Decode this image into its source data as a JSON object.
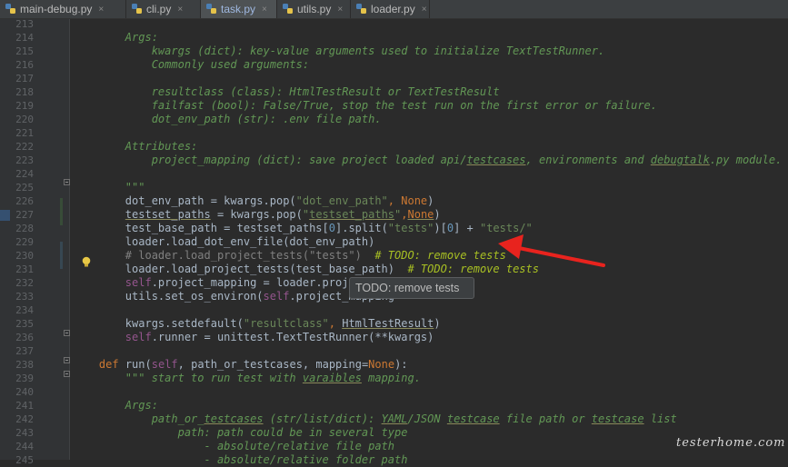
{
  "tabs": [
    {
      "label": "main-debug.py",
      "active": false,
      "close": "×"
    },
    {
      "label": "cli.py",
      "active": false,
      "close": "×"
    },
    {
      "label": "task.py",
      "active": true,
      "close": "×"
    },
    {
      "label": "utils.py",
      "active": false,
      "close": "×"
    },
    {
      "label": "loader.py",
      "active": false,
      "close": "×"
    }
  ],
  "lines": [
    {
      "no": "213",
      "segs": [
        {
          "t": "",
          "c": "t-plain"
        }
      ]
    },
    {
      "no": "214",
      "segs": [
        {
          "t": "        Args:",
          "c": "t-comment"
        }
      ]
    },
    {
      "no": "215",
      "segs": [
        {
          "t": "            kwargs (dict): key-value arguments used to initialize TextTestRunner.",
          "c": "t-comment"
        }
      ]
    },
    {
      "no": "216",
      "segs": [
        {
          "t": "            Commonly used arguments:",
          "c": "t-comment"
        }
      ]
    },
    {
      "no": "217",
      "segs": [
        {
          "t": "",
          "c": "t-plain"
        }
      ]
    },
    {
      "no": "218",
      "segs": [
        {
          "t": "            resultclass (class): HtmlTestResult or TextTestResult",
          "c": "t-comment"
        }
      ]
    },
    {
      "no": "219",
      "segs": [
        {
          "t": "            failfast (bool): False/True, stop the test run on the first error or failure.",
          "c": "t-comment"
        }
      ]
    },
    {
      "no": "220",
      "segs": [
        {
          "t": "            dot_env_path (str): .env file path.",
          "c": "t-comment"
        }
      ]
    },
    {
      "no": "221",
      "segs": [
        {
          "t": "",
          "c": "t-plain"
        }
      ]
    },
    {
      "no": "222",
      "segs": [
        {
          "t": "        Attributes:",
          "c": "t-comment"
        }
      ]
    },
    {
      "no": "223",
      "segs": [
        {
          "t": "            project_mapping (dict): save project loaded api/",
          "c": "t-comment"
        },
        {
          "t": "testcases",
          "c": "t-under"
        },
        {
          "t": ", environments and ",
          "c": "t-comment"
        },
        {
          "t": "debugtalk",
          "c": "t-under"
        },
        {
          "t": ".py module.",
          "c": "t-comment"
        }
      ]
    },
    {
      "no": "224",
      "segs": [
        {
          "t": "",
          "c": "t-plain"
        }
      ]
    },
    {
      "no": "225",
      "segs": [
        {
          "t": "        \"\"\"",
          "c": "t-comment"
        }
      ]
    },
    {
      "no": "226",
      "segs": [
        {
          "t": "        dot_env_path = kwargs.pop(",
          "c": "t-plain"
        },
        {
          "t": "\"dot_env_path\"",
          "c": "t-str"
        },
        {
          "t": ", ",
          "c": "t-kw"
        },
        {
          "t": "None",
          "c": "t-kw"
        },
        {
          "t": ")",
          "c": "t-plain"
        }
      ]
    },
    {
      "no": "227",
      "segs": [
        {
          "t": "        ",
          "c": "t-plain"
        },
        {
          "t": "testset_paths",
          "c": "t-underp"
        },
        {
          "t": " = kwargs.pop(",
          "c": "t-plain"
        },
        {
          "t": "\"",
          "c": "t-str"
        },
        {
          "t": "testset_paths",
          "c": "t-unders"
        },
        {
          "t": "\"",
          "c": "t-str"
        },
        {
          "t": ",",
          "c": "t-kw"
        },
        {
          "t": "None",
          "c": "t-underk"
        },
        {
          "t": ")",
          "c": "t-plain"
        }
      ]
    },
    {
      "no": "228",
      "segs": [
        {
          "t": "        test_base_path = testset_paths[",
          "c": "t-plain"
        },
        {
          "t": "0",
          "c": "t-num"
        },
        {
          "t": "].split(",
          "c": "t-plain"
        },
        {
          "t": "\"tests\"",
          "c": "t-str"
        },
        {
          "t": ")[",
          "c": "t-plain"
        },
        {
          "t": "0",
          "c": "t-num"
        },
        {
          "t": "] + ",
          "c": "t-plain"
        },
        {
          "t": "\"tests/\"",
          "c": "t-str"
        }
      ]
    },
    {
      "no": "229",
      "segs": [
        {
          "t": "        loader.load_dot_env_file(dot_env_path)",
          "c": "t-plain"
        }
      ]
    },
    {
      "no": "230",
      "segs": [
        {
          "t": "        # loader.load_project_tests(\"tests\")  ",
          "c": "t-pc"
        },
        {
          "t": "# TODO: remove tests",
          "c": "t-todo"
        }
      ]
    },
    {
      "no": "231",
      "segs": [
        {
          "t": "        loader.load_project_tests(test_base_path)  ",
          "c": "t-plain"
        },
        {
          "t": "# TODO: remove tests",
          "c": "t-todo"
        }
      ]
    },
    {
      "no": "232",
      "segs": [
        {
          "t": "        ",
          "c": "t-plain"
        },
        {
          "t": "self",
          "c": "t-self"
        },
        {
          "t": ".project_mapping = loader.project_mapping",
          "c": "t-plain"
        }
      ]
    },
    {
      "no": "233",
      "segs": [
        {
          "t": "        utils.set_os_environ(",
          "c": "t-plain"
        },
        {
          "t": "self",
          "c": "t-self"
        },
        {
          "t": ".project_mapping",
          "c": "t-plain"
        }
      ]
    },
    {
      "no": "234",
      "segs": [
        {
          "t": "",
          "c": "t-plain"
        }
      ]
    },
    {
      "no": "235",
      "segs": [
        {
          "t": "        kwargs.setdefault(",
          "c": "t-plain"
        },
        {
          "t": "\"resultclass\"",
          "c": "t-str"
        },
        {
          "t": ", ",
          "c": "t-kw"
        },
        {
          "t": "HtmlTestResult",
          "c": "t-underp"
        },
        {
          "t": ")",
          "c": "t-plain"
        }
      ]
    },
    {
      "no": "236",
      "segs": [
        {
          "t": "        ",
          "c": "t-plain"
        },
        {
          "t": "self",
          "c": "t-self"
        },
        {
          "t": ".runner = unittest.TextTestRunner(**kwargs)",
          "c": "t-plain"
        }
      ]
    },
    {
      "no": "237",
      "segs": [
        {
          "t": "",
          "c": "t-plain"
        }
      ]
    },
    {
      "no": "238",
      "segs": [
        {
          "t": "    ",
          "c": "t-plain"
        },
        {
          "t": "def",
          "c": "t-kw"
        },
        {
          "t": " ",
          "c": "t-plain"
        },
        {
          "t": "run",
          "c": "t-plain"
        },
        {
          "t": "(",
          "c": "t-plain"
        },
        {
          "t": "self",
          "c": "t-self"
        },
        {
          "t": ", path_or_testcases, mapping=",
          "c": "t-plain"
        },
        {
          "t": "None",
          "c": "t-kw"
        },
        {
          "t": "):",
          "c": "t-plain"
        }
      ]
    },
    {
      "no": "239",
      "segs": [
        {
          "t": "        \"\"\" start to run test with ",
          "c": "t-comment"
        },
        {
          "t": "varaibles",
          "c": "t-under"
        },
        {
          "t": " mapping.",
          "c": "t-comment"
        }
      ]
    },
    {
      "no": "240",
      "segs": [
        {
          "t": "",
          "c": "t-plain"
        }
      ]
    },
    {
      "no": "241",
      "segs": [
        {
          "t": "        Args:",
          "c": "t-comment"
        }
      ]
    },
    {
      "no": "242",
      "segs": [
        {
          "t": "            path_or_",
          "c": "t-comment"
        },
        {
          "t": "testcases",
          "c": "t-under"
        },
        {
          "t": " (str/list/dict): ",
          "c": "t-comment"
        },
        {
          "t": "YAML",
          "c": "t-under"
        },
        {
          "t": "/JSON ",
          "c": "t-comment"
        },
        {
          "t": "testcase",
          "c": "t-under"
        },
        {
          "t": " file path or ",
          "c": "t-comment"
        },
        {
          "t": "testcase",
          "c": "t-under"
        },
        {
          "t": " list",
          "c": "t-comment"
        }
      ]
    },
    {
      "no": "243",
      "segs": [
        {
          "t": "                path: path could be in several type",
          "c": "t-comment"
        }
      ]
    },
    {
      "no": "244",
      "segs": [
        {
          "t": "                    - absolute/relative file path",
          "c": "t-comment"
        }
      ]
    },
    {
      "no": "245",
      "segs": [
        {
          "t": "                    - absolute/relative folder path",
          "c": "t-comment"
        }
      ]
    }
  ],
  "tooltip": "TODO: remove tests",
  "watermark": "testerhome.com",
  "colors": {
    "arrow": "#e8231e",
    "background": "#2b2b2b"
  }
}
